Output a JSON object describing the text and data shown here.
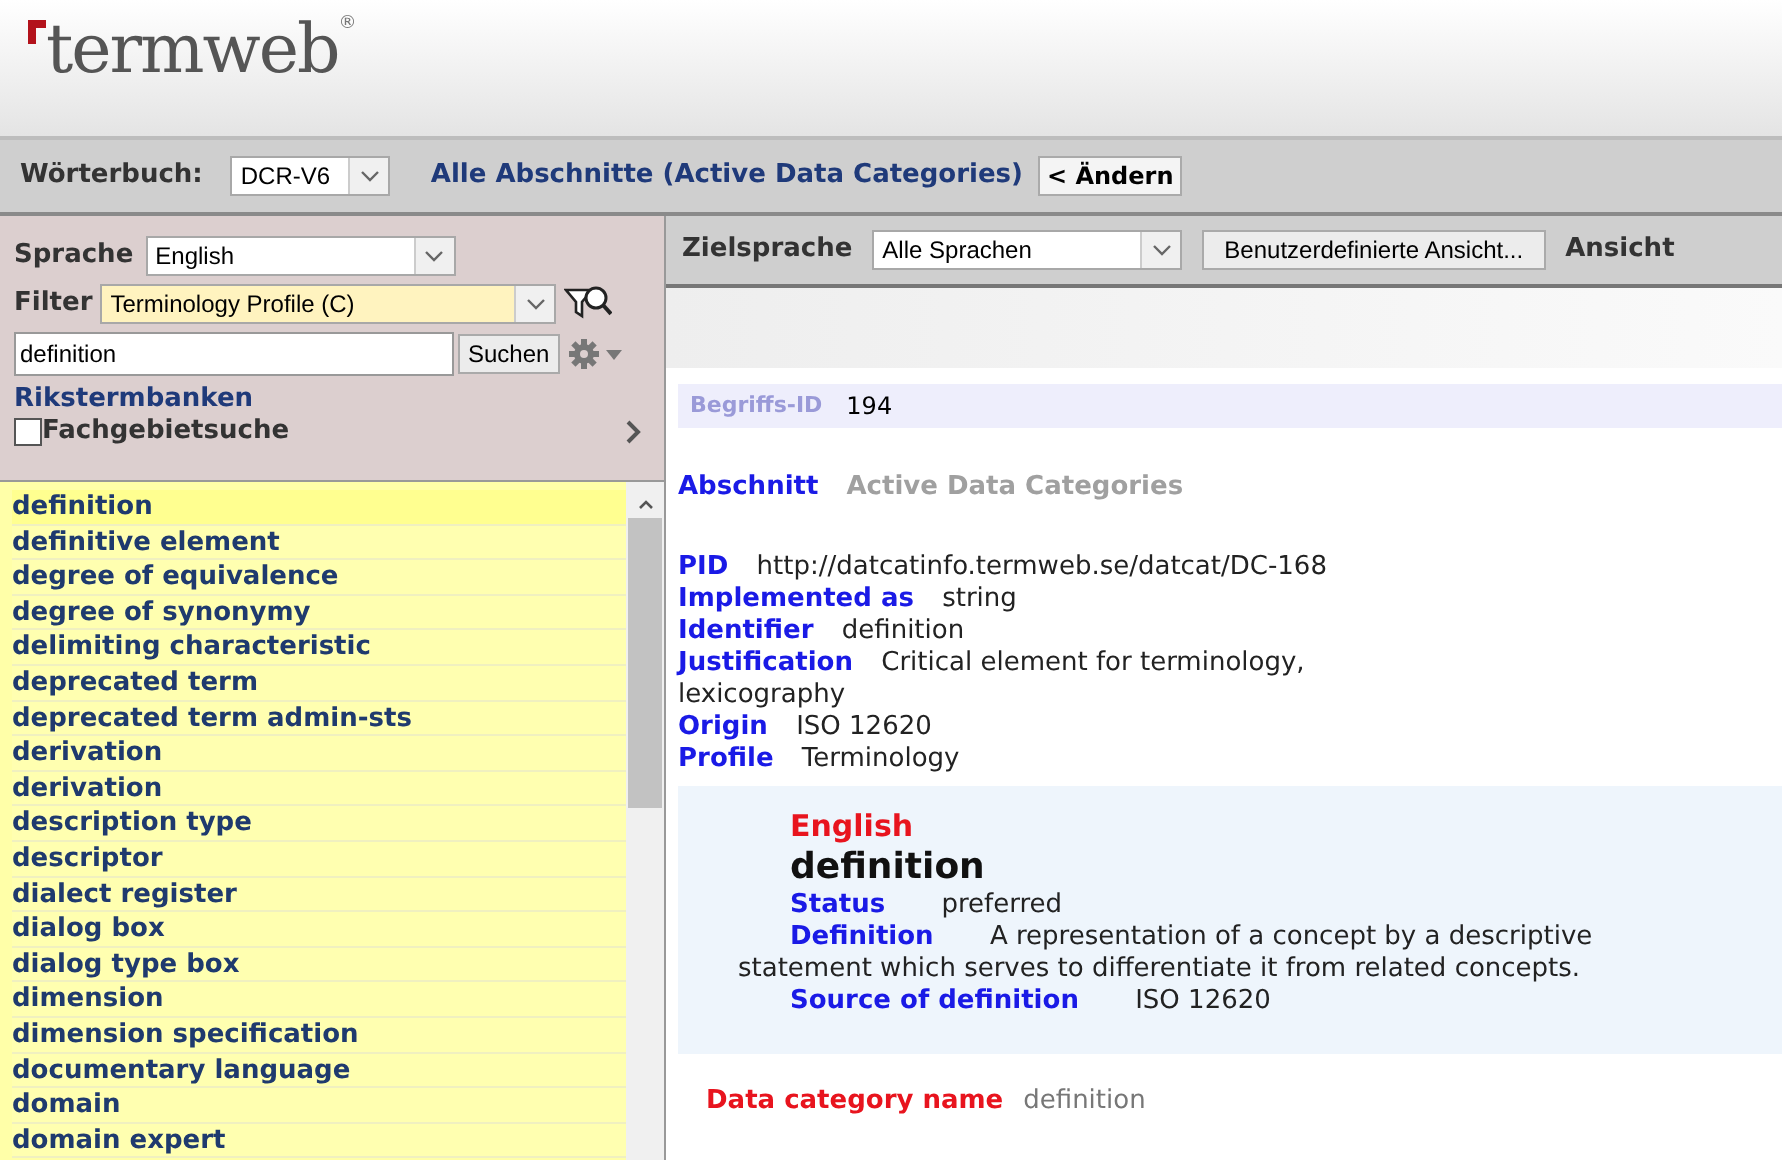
{
  "logo": {
    "text": "termweb",
    "mark": "®"
  },
  "toolbar": {
    "dictionary_label": "Wörterbuch:",
    "dictionary_value": "DCR-V6",
    "section": "Alle Abschnitte (Active Data Categories)",
    "change_button": "< Ändern"
  },
  "search_panel": {
    "language_label": "Sprache",
    "language_value": "English",
    "filter_label": "Filter",
    "filter_value": "Terminology Profile (C)",
    "query": "definition",
    "search_button": "Suchen",
    "link": "Rikstermbanken",
    "domain_search": {
      "label": "Fachgebietsuche",
      "checked": false
    }
  },
  "term_list": [
    {
      "label": "definition",
      "selected": true
    },
    {
      "label": "definitive element",
      "selected": false
    },
    {
      "label": "degree of equivalence",
      "selected": false
    },
    {
      "label": "degree of synonymy",
      "selected": false
    },
    {
      "label": "delimiting characteristic",
      "selected": false
    },
    {
      "label": "deprecated term",
      "selected": false
    },
    {
      "label": "deprecated term admin-sts",
      "selected": false
    },
    {
      "label": "derivation",
      "selected": false
    },
    {
      "label": "derivation",
      "selected": false
    },
    {
      "label": "description type",
      "selected": false
    },
    {
      "label": "descriptor",
      "selected": false
    },
    {
      "label": "dialect register",
      "selected": false
    },
    {
      "label": "dialog box",
      "selected": false
    },
    {
      "label": "dialog type box",
      "selected": false
    },
    {
      "label": "dimension",
      "selected": false
    },
    {
      "label": "dimension specification",
      "selected": false
    },
    {
      "label": "documentary language",
      "selected": false
    },
    {
      "label": "domain",
      "selected": false
    },
    {
      "label": "domain expert",
      "selected": false
    }
  ],
  "view_bar": {
    "target_label": "Zielsprache",
    "target_value": "Alle Sprachen",
    "custom_view_button": "Benutzerdefinierte Ansicht...",
    "view_label": "Ansicht"
  },
  "entry": {
    "concept_id_label": "Begriffs-ID",
    "concept_id": "194",
    "section_label": "Abschnitt",
    "section_value": "Active Data Categories",
    "fields": [
      {
        "label": "PID",
        "value": "http://datcatinfo.termweb.se/datcat/DC-168"
      },
      {
        "label": "Implemented as",
        "value": "string"
      },
      {
        "label": "Identifier",
        "value": "definition"
      },
      {
        "label": "Justification",
        "value": "Critical element for terminology, lexicography"
      },
      {
        "label": "Origin",
        "value": "ISO 12620"
      },
      {
        "label": "Profile",
        "value": "Terminology"
      }
    ],
    "language_block": {
      "language": "English",
      "term": "definition",
      "fields": [
        {
          "label": "Status",
          "value": "preferred"
        },
        {
          "label": "Definition",
          "value": "A representation of a concept by a descriptive statement which serves to differentiate it from related concepts."
        },
        {
          "label": "Source of definition",
          "value": "ISO 12620"
        }
      ]
    },
    "data_category_label": "Data category name",
    "data_category_value": "definition"
  }
}
